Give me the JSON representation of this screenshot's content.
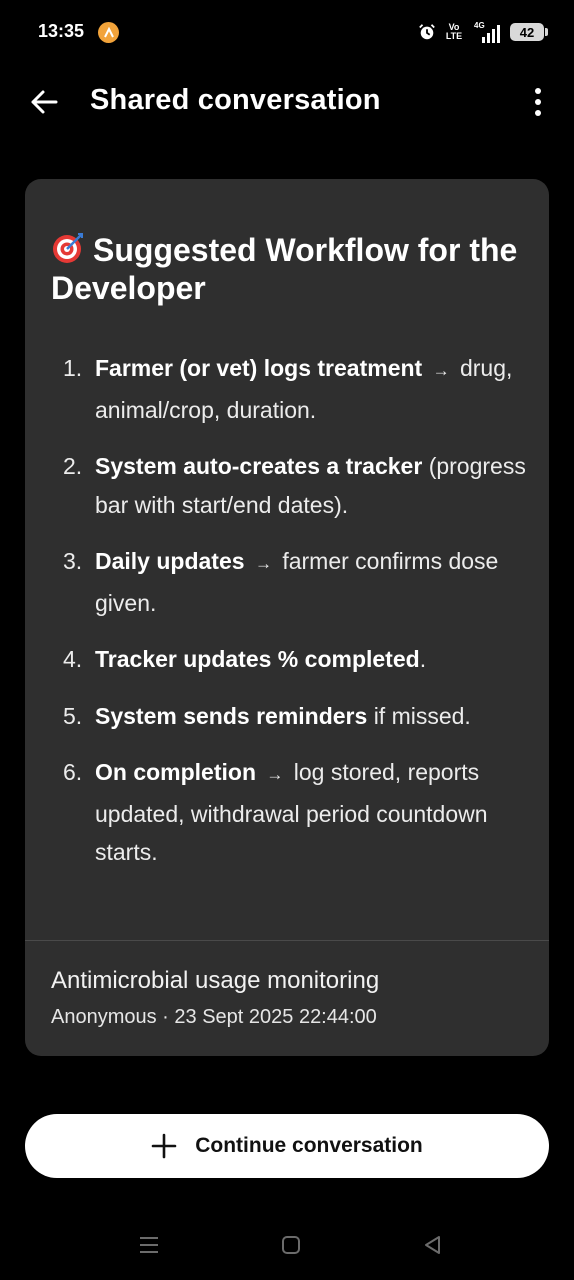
{
  "status_bar": {
    "time": "13:35",
    "volte_top": "Vo",
    "volte_bottom": "LTE",
    "network": "4G",
    "battery": "42"
  },
  "app_bar": {
    "title": "Shared conversation"
  },
  "card": {
    "heading": "Suggested Workflow for the Developer",
    "heading_icon": "target-icon",
    "steps": [
      {
        "num": "1.",
        "bold": "Farmer (or vet) logs treatment",
        "arrow": "→",
        "rest": "drug, animal/crop, duration."
      },
      {
        "num": "2.",
        "bold": "System auto-creates a tracker",
        "rest": "(progress bar with start/end dates)."
      },
      {
        "num": "3.",
        "bold": "Daily updates",
        "arrow": "→",
        "rest": "farmer confirms dose given."
      },
      {
        "num": "4.",
        "bold": "Tracker updates % completed",
        "rest": "."
      },
      {
        "num": "5.",
        "bold": "System sends reminders",
        "rest": "if missed."
      },
      {
        "num": "6.",
        "bold": "On completion",
        "arrow": "→",
        "rest": "log stored, reports updated, withdrawal period countdown starts."
      }
    ],
    "footer_title": "Antimicrobial usage monitoring",
    "footer_meta": "Anonymous · 23 Sept 2025 22:44:00"
  },
  "continue_button": {
    "label": "Continue conversation"
  },
  "colors": {
    "background": "#000000",
    "card": "#2f2f2f",
    "button": "#ffffff",
    "target_red": "#e53935"
  }
}
